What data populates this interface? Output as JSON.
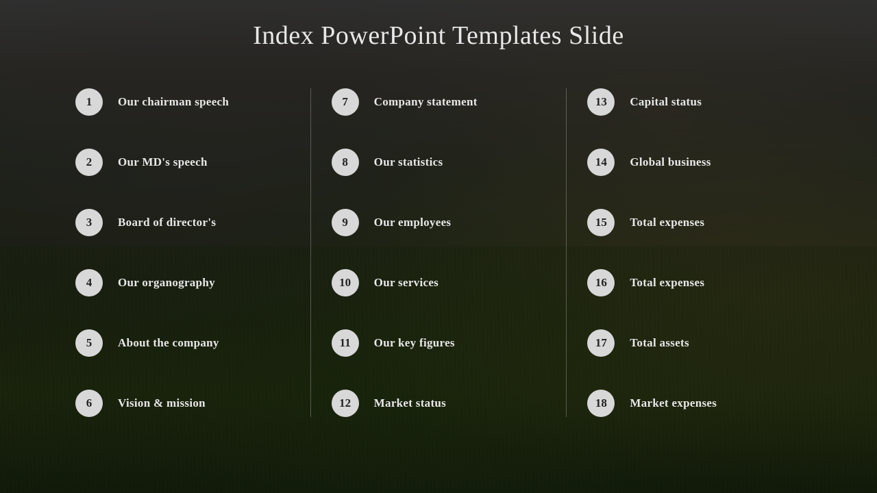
{
  "title": "Index PowerPoint Templates Slide",
  "columns": [
    {
      "items": [
        {
          "num": "1",
          "label": "Our chairman speech"
        },
        {
          "num": "2",
          "label": "Our MD's  speech"
        },
        {
          "num": "3",
          "label": "Board of director's"
        },
        {
          "num": "4",
          "label": "Our organography"
        },
        {
          "num": "5",
          "label": "About the company"
        },
        {
          "num": "6",
          "label": "Vision & mission"
        }
      ]
    },
    {
      "items": [
        {
          "num": "7",
          "label": "Company statement"
        },
        {
          "num": "8",
          "label": "Our statistics"
        },
        {
          "num": "9",
          "label": "Our employees"
        },
        {
          "num": "10",
          "label": "Our services"
        },
        {
          "num": "11",
          "label": "Our key figures"
        },
        {
          "num": "12",
          "label": "Market status"
        }
      ]
    },
    {
      "items": [
        {
          "num": "13",
          "label": "Capital status"
        },
        {
          "num": "14",
          "label": "Global business"
        },
        {
          "num": "15",
          "label": "Total expenses"
        },
        {
          "num": "16",
          "label": "Total expenses"
        },
        {
          "num": "17",
          "label": "Total assets"
        },
        {
          "num": "18",
          "label": "Market expenses"
        }
      ]
    }
  ]
}
